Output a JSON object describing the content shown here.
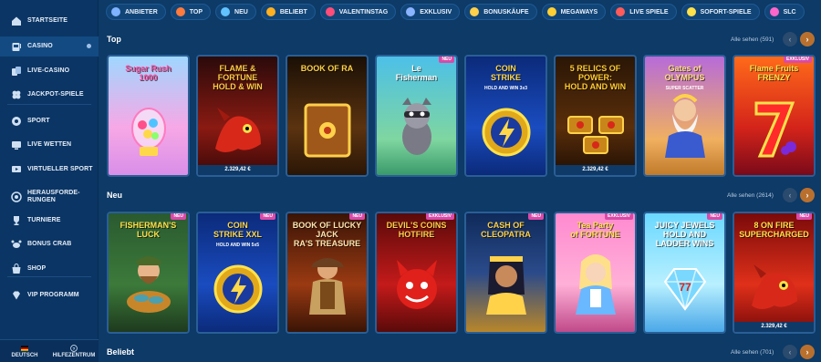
{
  "sidebar": {
    "items": [
      {
        "label": "STARTSEITE",
        "icon": "home-icon"
      },
      {
        "label": "CASINO",
        "icon": "slot-machine-icon"
      },
      {
        "label": "LIVE-CASINO",
        "icon": "cards-icon"
      },
      {
        "label": "JACKPOT-SPIELE",
        "icon": "clover-icon"
      },
      {
        "label": "SPORT",
        "icon": "ball-icon"
      },
      {
        "label": "LIVE WETTEN",
        "icon": "screen-icon"
      },
      {
        "label": "VIRTUELLER SPORT",
        "icon": "virtual-screen-icon"
      },
      {
        "label": "HERAUSFORDE-",
        "label2": "RUNGEN",
        "icon": "challenge-icon"
      },
      {
        "label": "TURNIERE",
        "icon": "trophy-icon"
      },
      {
        "label": "BONUS CRAB",
        "icon": "crab-icon"
      },
      {
        "label": "SHOP",
        "icon": "shop-icon"
      },
      {
        "label": "VIP PROGRAMM",
        "icon": "diamond-icon"
      }
    ],
    "bottom": {
      "language": "DEUTSCH",
      "help": "HILFEZENTRUM"
    }
  },
  "categories": [
    {
      "label": "ANBIETER",
      "color": "#7fb2ff"
    },
    {
      "label": "TOP",
      "color": "#ff7a3d"
    },
    {
      "label": "NEU",
      "color": "#62c3ff"
    },
    {
      "label": "BELIEBT",
      "color": "#ffb020"
    },
    {
      "label": "VALENTINSTAG",
      "color": "#ff4d7a"
    },
    {
      "label": "EXKLUSIV",
      "color": "#8ab4ff"
    },
    {
      "label": "BONUSKÄUFE",
      "color": "#ffd04a"
    },
    {
      "label": "MEGAWAYS",
      "color": "#ffcf33"
    },
    {
      "label": "LIVE SPIELE",
      "color": "#ff5b5b"
    },
    {
      "label": "SOFORT-SPIELE",
      "color": "#ffe14a"
    },
    {
      "label": "SLC",
      "color": "#ff66cc"
    }
  ],
  "sections": [
    {
      "title": "Top",
      "see_all": "Alle sehen (591)",
      "games": [
        {
          "title": "Sugar Rush",
          "title2": "1000",
          "bg": "linear-gradient(180deg,#9fd7ff,#f7a8e6 60%,#d98ee8)",
          "title_color": "#ff4fa3",
          "badge": "",
          "jackpot": "",
          "art": "egg"
        },
        {
          "title": "FLAME & FORTUNE",
          "title2": "HOLD & WIN",
          "bg": "linear-gradient(180deg,#2a0a0a,#8a1a12 60%,#3a0808)",
          "title_color": "#ffcc44",
          "badge": "",
          "jackpot": "2.329,42 €",
          "art": "dragon"
        },
        {
          "title": "BOOK OF RA",
          "title2": "",
          "bg": "linear-gradient(180deg,#1a0f05,#5b3310 60%,#2a1606)",
          "title_color": "#ffd24a",
          "badge": "",
          "jackpot": "",
          "art": "book"
        },
        {
          "title": "Le",
          "title2": "Fisherman",
          "bg": "linear-gradient(180deg,#4cc0e8,#7fd6a0 70%,#3a9a6a)",
          "title_color": "#ffffff",
          "badge": "NEU",
          "jackpot": "",
          "art": "raccoon"
        },
        {
          "title": "COIN",
          "title2": "STRIKE",
          "sub": "HOLD AND WIN 3x3",
          "bg": "linear-gradient(180deg,#0b2a7a,#1a4cc0 60%,#0b2a7a)",
          "title_color": "#ffd84a",
          "badge": "",
          "jackpot": "",
          "art": "coin"
        },
        {
          "title": "5 RELICS OF POWER:",
          "title2": "HOLD AND WIN",
          "bg": "linear-gradient(180deg,#2a1606,#5a2e0a 60%,#1e0e04)",
          "title_color": "#ffcc33",
          "badge": "",
          "jackpot": "2.329,42 €",
          "art": "relic"
        },
        {
          "title": "Gates of",
          "title2": "OLYMPUS",
          "sub": "SUPER SCATTER",
          "bg": "linear-gradient(180deg,#b76bd9,#f0b060 70%,#c07a2a)",
          "title_color": "#ffe080",
          "badge": "",
          "jackpot": "",
          "art": "zeus"
        },
        {
          "title": "Flame Fruits",
          "title2": "FRENZY",
          "bg": "linear-gradient(180deg,#ff6a1a,#d4241a 60%,#7a0a1a)",
          "title_color": "#ffe14a",
          "badge": "EXKLUSIV",
          "jackpot": "",
          "art": "seven"
        }
      ]
    },
    {
      "title": "Neu",
      "see_all": "Alle sehen (2614)",
      "games": [
        {
          "title": "FISHERMAN'S",
          "title2": "LUCK",
          "bg": "linear-gradient(180deg,#2a5a30,#3c7a3a 60%,#1e3a1e)",
          "title_color": "#ffe14a",
          "badge": "NEU",
          "jackpot": "",
          "art": "fisher"
        },
        {
          "title": "COIN",
          "title2": "STRIKE XXL",
          "sub": "HOLD AND WIN 5x5",
          "bg": "linear-gradient(180deg,#0b2a7a,#1a4cc0 60%,#0b2a7a)",
          "title_color": "#ffd84a",
          "badge": "NEU",
          "jackpot": "",
          "art": "coin"
        },
        {
          "title": "BOOK OF LUCKY JACK",
          "title2": "RA'S TREASURE",
          "bg": "linear-gradient(180deg,#3a1406,#9a3a12 60%,#3a1406)",
          "title_color": "#ffe6b0",
          "badge": "NEU",
          "jackpot": "",
          "art": "explorer"
        },
        {
          "title": "DEVIL'S COINS",
          "title2": "HOTFIRE",
          "bg": "linear-gradient(180deg,#5a0a0a,#c41a1a 60%,#5a0a0a)",
          "title_color": "#ffd24a",
          "badge": "EXKLUSIV",
          "jackpot": "",
          "art": "devil"
        },
        {
          "title": "CASH OF",
          "title2": "CLEOPATRA",
          "bg": "linear-gradient(180deg,#0f2a5a,#2a4a8a 50%,#b8862a)",
          "title_color": "#ffd24a",
          "badge": "NEU",
          "jackpot": "",
          "art": "cleo"
        },
        {
          "title": "Tea Party",
          "title2": "of FORTUNE",
          "bg": "linear-gradient(180deg,#ff8ad0,#ffb0d8 60%,#c04a8a)",
          "title_color": "#ffe14a",
          "badge": "EXKLUSIV",
          "jackpot": "",
          "art": "alice"
        },
        {
          "title": "JUICY JEWELS",
          "title2": "HOLD AND LADDER WINS",
          "bg": "linear-gradient(180deg,#6ad8ff,#b8f0ff 60%,#4aa8e8)",
          "title_color": "#ffffff",
          "badge": "NEU",
          "jackpot": "",
          "art": "jewel"
        },
        {
          "title": "8 ON FIRE",
          "title2": "SUPERCHARGED",
          "bg": "linear-gradient(180deg,#7a0a0a,#e0301a 60%,#7a0a0a)",
          "title_color": "#ffe14a",
          "badge": "NEU",
          "jackpot": "2.329,42 €",
          "art": "dragon"
        }
      ]
    },
    {
      "title": "Beliebt",
      "see_all": "Alle sehen (701)",
      "games": []
    }
  ],
  "nav": {
    "prev": "‹",
    "next": "›"
  }
}
